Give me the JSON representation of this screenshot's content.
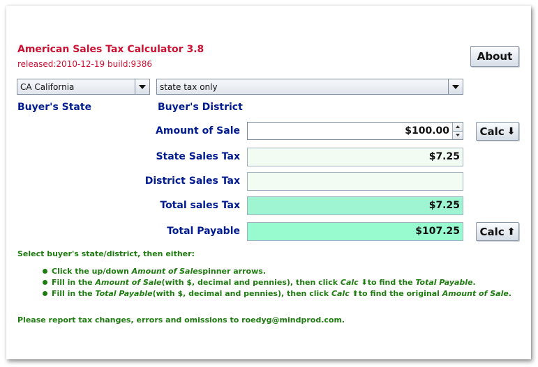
{
  "app": {
    "title": "American Sales Tax Calculator 3.8",
    "subtitle": "released:2010-12-19 build:9386",
    "about_label": "About"
  },
  "selectors": {
    "state_value": "CA California",
    "district_value": "state tax only",
    "state_label": "Buyer's State",
    "district_label": "Buyer's District"
  },
  "fields": {
    "amount_of_sale": {
      "label": "Amount of Sale",
      "value": "$100.00"
    },
    "state_sales_tax": {
      "label": "State Sales Tax",
      "value": "$7.25"
    },
    "district_sales_tax": {
      "label": "District Sales Tax",
      "value": ""
    },
    "total_sales_tax": {
      "label": "Total sales Tax",
      "value": "$7.25"
    },
    "total_payable": {
      "label": "Total Payable",
      "value": "$107.25"
    }
  },
  "buttons": {
    "calc_down_label": "Calc",
    "calc_down_arrow": "⬇",
    "calc_up_label": "Calc",
    "calc_up_arrow": "⬆"
  },
  "instructions": {
    "intro": "Select buyer's state/district, then either:",
    "b1_a": "Click the up/down ",
    "b1_b": "Amount of Sale",
    "b1_c": " spinner arrows.",
    "b2_a": "Fill in the ",
    "b2_b": "Amount of Sale",
    "b2_c": " (with $, decimal and pennies), then click ",
    "b2_d": "Calc ⬇",
    "b2_e": " to find the ",
    "b2_f": "Total Payable",
    "b2_g": ".",
    "b3_a": "Fill in the ",
    "b3_b": "Total Payable",
    "b3_c": " (with $, decimal and pennies), then click ",
    "b3_d": "Calc ⬆",
    "b3_e": " to find the original ",
    "b3_f": "Amount of Sale",
    "b3_g": ".",
    "footer": "Please report tax changes, errors and omissions to roedyg@mindprod.com."
  },
  "colors": {
    "title_red": "#cc1133",
    "label_blue": "#001b8f",
    "instruction_green": "#1e7b10",
    "state_tax_bg": "#f2fcf2",
    "district_tax_bg": "#f2fcf2",
    "total_tax_bg": "#9ff5d2",
    "total_payable_bg": "#98fbd0"
  },
  "icons": {
    "combo_dropdown": "triangle-down-icon",
    "spinner_up": "triangle-up-icon",
    "spinner_down": "triangle-down-icon",
    "calc_down": "arrow-down-icon",
    "calc_up": "arrow-up-icon",
    "bullet": "bullet-dot-icon"
  }
}
